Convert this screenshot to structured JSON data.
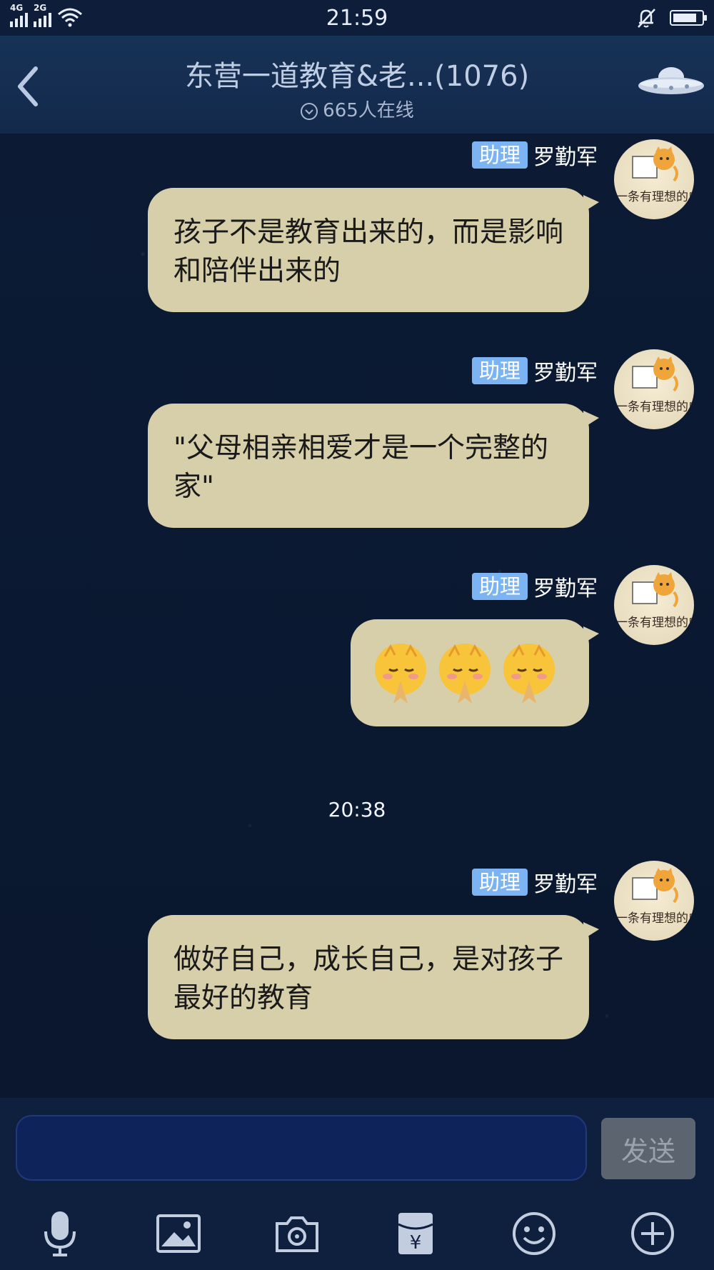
{
  "status_bar": {
    "time": "21:59",
    "network_1": "4G",
    "network_2": "2G"
  },
  "header": {
    "title": "东营一道教育&老...(1076)",
    "online": "665人在线"
  },
  "messages": [
    {
      "role": "助理",
      "sender": "罗勤军",
      "avatar_text": "一条有理想的咸鱼",
      "text": "孩子不是教育出来的，而是影响和陪伴出来的"
    },
    {
      "role": "助理",
      "sender": "罗勤军",
      "avatar_text": "一条有理想的咸鱼",
      "text": "\"父母相亲相爱才是一个完整的家\""
    },
    {
      "role": "助理",
      "sender": "罗勤军",
      "avatar_text": "一条有理想的咸鱼",
      "emoji": [
        "praying-face",
        "praying-face",
        "praying-face"
      ]
    },
    {
      "role": "助理",
      "sender": "罗勤军",
      "avatar_text": "一条有理想的咸鱼",
      "text": "做好自己，成长自己，是对孩子最好的教育"
    }
  ],
  "time_divider": "20:38",
  "input": {
    "value": "",
    "send_label": "发送"
  },
  "toolbar": {
    "icons": [
      "microphone-icon",
      "image-icon",
      "camera-icon",
      "red-packet-icon",
      "emoji-icon",
      "plus-icon"
    ]
  },
  "colors": {
    "bubble": "#d7ceaa",
    "badge": "#7cb4f3",
    "background": "#0b1a33",
    "header": "#173257"
  }
}
